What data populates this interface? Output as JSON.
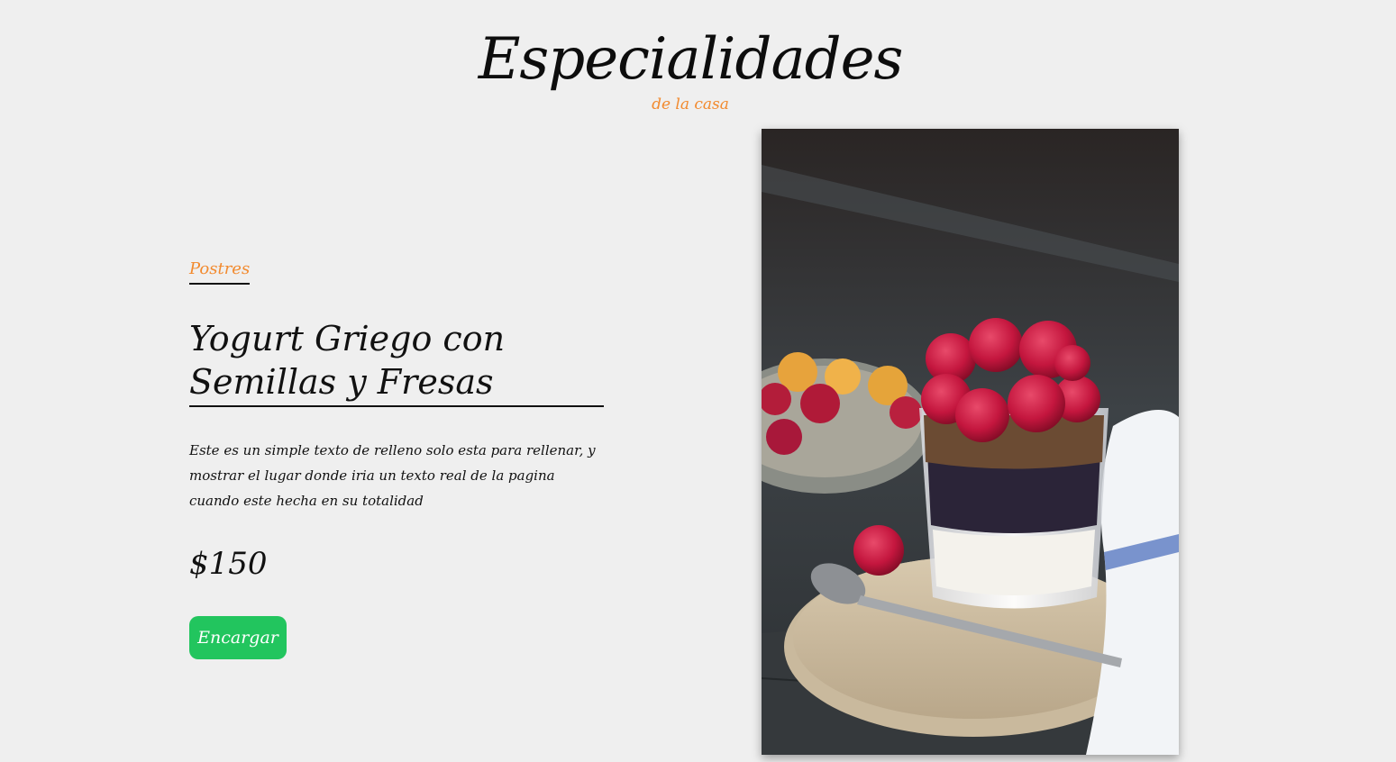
{
  "header": {
    "title": "Especialidades",
    "subtitle": "de la casa"
  },
  "item": {
    "category": "Postres",
    "title": "Yogurt Griego con Semillas y Fresas",
    "description": "Este es un simple texto de relleno solo esta para rellenar, y mostrar el lugar donde iria un texto real de la pagina cuando este hecha en su totalidad",
    "price": "$150",
    "button_label": "Encargar"
  },
  "colors": {
    "background": "#efefef",
    "accent": "#f28a2e",
    "button": "#22c55e"
  }
}
